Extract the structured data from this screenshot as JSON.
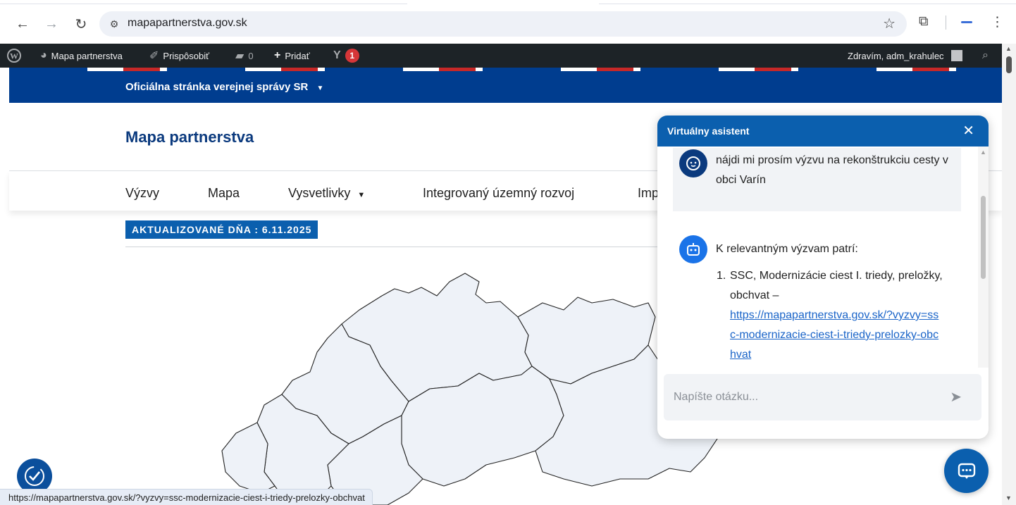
{
  "browser": {
    "url": "mapapartnerstva.gov.sk",
    "back_icon": "arrow-left-icon",
    "forward_icon": "arrow-right-icon",
    "reload_icon": "reload-icon",
    "menu_icon": "kebab-menu-icon"
  },
  "admin_bar": {
    "site_name": "Mapa partnerstva",
    "customize": "Prispôsobiť",
    "comments_count": "0",
    "add_new": "Pridať",
    "updates_count": "1",
    "greeting": "Zdravím, adm_krahulec"
  },
  "gov_band": {
    "title": "Oficiálna stránka verejnej správy SR",
    "caret": "▼"
  },
  "site": {
    "title": "Mapa partnerstva",
    "nav": [
      "Výzvy",
      "Mapa",
      "Vysvetlivky",
      "Integrovaný územný rozvoj",
      "Imp"
    ],
    "nav_caret": "▼",
    "updated": "AKTUALIZOVANÉ DŇA : 6.11.2025"
  },
  "chat": {
    "title": "Virtuálny asistent",
    "close": "✕",
    "user_message": "nájdi mi prosím výzvu na rekonštrukciu cesty v obci Varín",
    "bot_intro": "K relevantným výzvam patrí:",
    "bot_item_number": "1.",
    "bot_item_text": "SSC, Modernizácie ciest I. triedy, preložky, obchvat –",
    "bot_item_link": "https://mapapartnerstva.gov.sk/?vyzvy=ssc-modernizacie-ciest-i-triedy-prelozky-obchvat",
    "input_placeholder": "Napíšte otázku...",
    "colors": {
      "header": "#0b5fae",
      "user_bubble": "#f1f3f6",
      "link": "#1a64c8"
    }
  },
  "status_bar": {
    "url": "https://mapapartnerstva.gov.sk/?vyzvy=ssc-modernizacie-ciest-i-triedy-prelozky-obchvat"
  }
}
